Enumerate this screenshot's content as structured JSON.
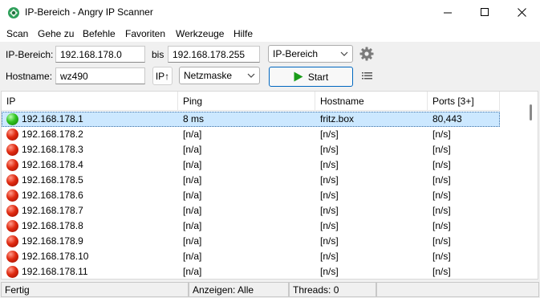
{
  "window": {
    "title": "IP-Bereich - Angry IP Scanner"
  },
  "menu": [
    "Scan",
    "Gehe zu",
    "Befehle",
    "Favoriten",
    "Werkzeuge",
    "Hilfe"
  ],
  "toolbar": {
    "range_label": "IP-Bereich:",
    "range_start": "192.168.178.0",
    "range_to_label": "bis",
    "range_end": "192.168.178.255",
    "feeder_select": "IP-Bereich",
    "hostname_label": "Hostname:",
    "hostname_value": "wz490",
    "ip_up_button": "IP↑",
    "netmask_select": "Netzmaske",
    "start_button": "Start"
  },
  "table": {
    "columns": [
      "IP",
      "Ping",
      "Hostname",
      "Ports [3+]"
    ],
    "rows": [
      {
        "status": "alive",
        "ip": "192.168.178.1",
        "ping": "8 ms",
        "hostname": "fritz.box",
        "ports": "80,443"
      },
      {
        "status": "dead",
        "ip": "192.168.178.2",
        "ping": "[n/a]",
        "hostname": "[n/s]",
        "ports": "[n/s]"
      },
      {
        "status": "dead",
        "ip": "192.168.178.3",
        "ping": "[n/a]",
        "hostname": "[n/s]",
        "ports": "[n/s]"
      },
      {
        "status": "dead",
        "ip": "192.168.178.4",
        "ping": "[n/a]",
        "hostname": "[n/s]",
        "ports": "[n/s]"
      },
      {
        "status": "dead",
        "ip": "192.168.178.5",
        "ping": "[n/a]",
        "hostname": "[n/s]",
        "ports": "[n/s]"
      },
      {
        "status": "dead",
        "ip": "192.168.178.6",
        "ping": "[n/a]",
        "hostname": "[n/s]",
        "ports": "[n/s]"
      },
      {
        "status": "dead",
        "ip": "192.168.178.7",
        "ping": "[n/a]",
        "hostname": "[n/s]",
        "ports": "[n/s]"
      },
      {
        "status": "dead",
        "ip": "192.168.178.8",
        "ping": "[n/a]",
        "hostname": "[n/s]",
        "ports": "[n/s]"
      },
      {
        "status": "dead",
        "ip": "192.168.178.9",
        "ping": "[n/a]",
        "hostname": "[n/s]",
        "ports": "[n/s]"
      },
      {
        "status": "dead",
        "ip": "192.168.178.10",
        "ping": "[n/a]",
        "hostname": "[n/s]",
        "ports": "[n/s]"
      },
      {
        "status": "dead",
        "ip": "192.168.178.11",
        "ping": "[n/a]",
        "hostname": "[n/s]",
        "ports": "[n/s]"
      }
    ]
  },
  "status": {
    "state": "Fertig",
    "display": "Anzeigen: Alle",
    "threads": "Threads: 0"
  },
  "icons": {
    "app": "angry-ip-logo-icon",
    "settings": "gear-icon",
    "columns": "list-columns-icon",
    "start": "play-icon"
  },
  "colors": {
    "alive": "#2fc21e",
    "dead": "#e02a10",
    "selection": "#cce8ff",
    "start_arrow": "#1a9c1a"
  }
}
